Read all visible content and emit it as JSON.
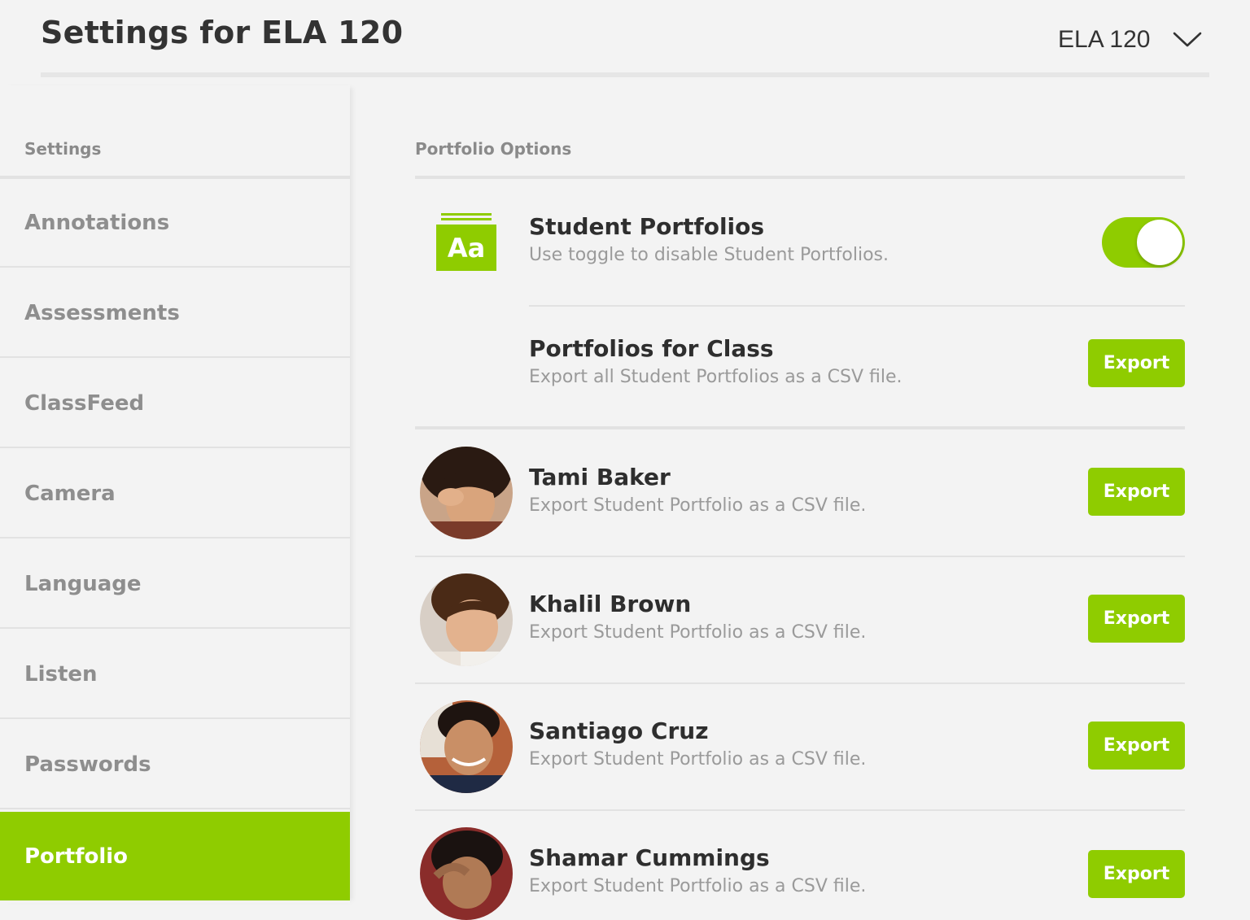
{
  "header": {
    "title": "Settings for ELA 120",
    "class_selector": "ELA 120"
  },
  "sidebar": {
    "heading": "Settings",
    "items": [
      {
        "label": "Annotations"
      },
      {
        "label": "Assessments"
      },
      {
        "label": "ClassFeed"
      },
      {
        "label": "Camera"
      },
      {
        "label": "Language"
      },
      {
        "label": "Listen"
      },
      {
        "label": "Passwords"
      },
      {
        "label": "Portfolio",
        "active": true
      }
    ]
  },
  "main": {
    "section_heading": "Portfolio Options",
    "student_portfolios": {
      "icon_text": "Aa",
      "title": "Student Portfolios",
      "subtitle": "Use toggle to disable Student Portfolios.",
      "toggle_on": true
    },
    "class_export": {
      "title": "Portfolios for Class",
      "subtitle": "Export all Student Portfolios as a CSV file.",
      "button": "Export"
    },
    "students": [
      {
        "name": "Tami Baker",
        "subtitle": "Export Student Portfolio as a CSV file.",
        "button": "Export"
      },
      {
        "name": "Khalil Brown",
        "subtitle": "Export Student Portfolio as a CSV file.",
        "button": "Export"
      },
      {
        "name": "Santiago Cruz",
        "subtitle": "Export Student Portfolio as a CSV file.",
        "button": "Export"
      },
      {
        "name": "Shamar Cummings",
        "subtitle": "Export Student Portfolio as a CSV file.",
        "button": "Export"
      }
    ]
  },
  "colors": {
    "accent": "#8fcc00",
    "background": "#f3f3f3",
    "text_dark": "#2e2e2e",
    "text_muted": "#9a9a9a"
  },
  "icons": [
    "chevron-down-icon",
    "portfolio-icon",
    "toggle",
    "avatar"
  ]
}
